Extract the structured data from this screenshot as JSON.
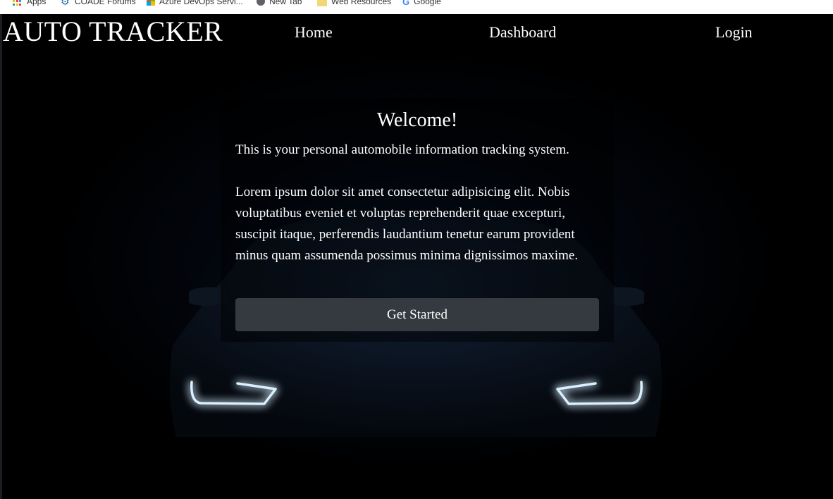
{
  "bookmarks": [
    {
      "label": "Apps",
      "icon": "apps-grid-icon"
    },
    {
      "label": "COADE Forums",
      "icon": "gear-icon"
    },
    {
      "label": "Azure DevOps Servi...",
      "icon": "azure-icon"
    },
    {
      "label": "New Tab",
      "icon": "globe-icon"
    },
    {
      "label": "Web Resources",
      "icon": "folder-icon"
    },
    {
      "label": "Google",
      "icon": "google-icon"
    }
  ],
  "navbar": {
    "brand": "AUTO TRACKER",
    "links": [
      "Home",
      "Dashboard",
      "Login"
    ]
  },
  "welcome": {
    "title": "Welcome!",
    "intro": "This is your personal automobile information tracking system.",
    "body": "Lorem ipsum dolor sit amet consectetur adipisicing elit. Nobis voluptatibus eveniet et voluptas reprehenderit quae excepturi, suscipit itaque, perferendis laudantium tenetur earum provident minus quam assumenda possimus minima dignissimos maxime.",
    "button_label": "Get Started"
  },
  "colors": {
    "background": "#000000",
    "button": "#343a40",
    "text": "#ffffff",
    "headlight_glow": "#9fd2ff"
  }
}
